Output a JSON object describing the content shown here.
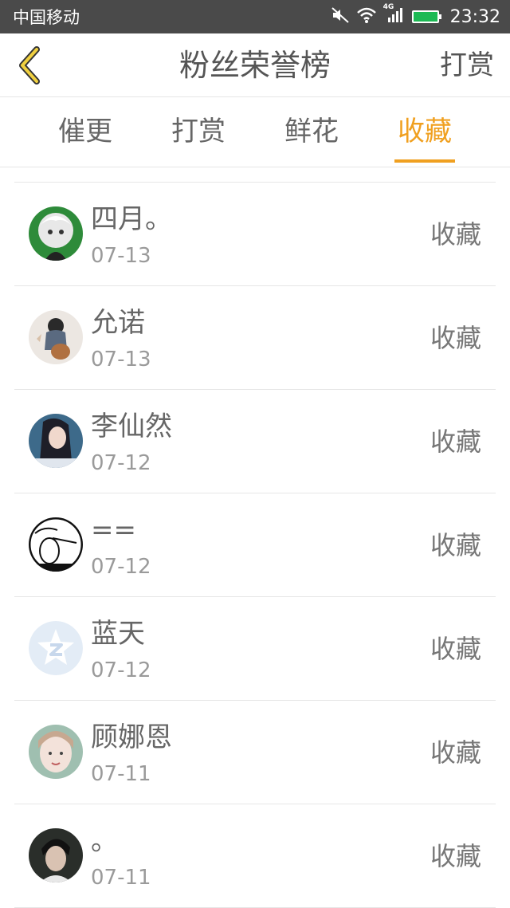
{
  "status_bar": {
    "carrier": "中国移动",
    "network": "4G",
    "time": "23:32"
  },
  "header": {
    "title": "粉丝荣誉榜",
    "action": "打赏",
    "back_icon": "chevron-left-icon",
    "accent_color": "#f0a020"
  },
  "tabs": [
    {
      "label": "催更",
      "active": false
    },
    {
      "label": "打赏",
      "active": false
    },
    {
      "label": "鲜花",
      "active": false
    },
    {
      "label": "收藏",
      "active": true
    }
  ],
  "items": [
    {
      "name": "四月。",
      "date": "07-13",
      "action": "收藏"
    },
    {
      "name": "允诺",
      "date": "07-13",
      "action": "收藏"
    },
    {
      "name": "李仙然",
      "date": "07-12",
      "action": "收藏"
    },
    {
      "name": "==",
      "date": "07-12",
      "action": "收藏"
    },
    {
      "name": "蓝天",
      "date": "07-12",
      "action": "收藏"
    },
    {
      "name": "顾娜恩",
      "date": "07-11",
      "action": "收藏"
    },
    {
      "name": "。",
      "date": "07-11",
      "action": "收藏"
    }
  ]
}
